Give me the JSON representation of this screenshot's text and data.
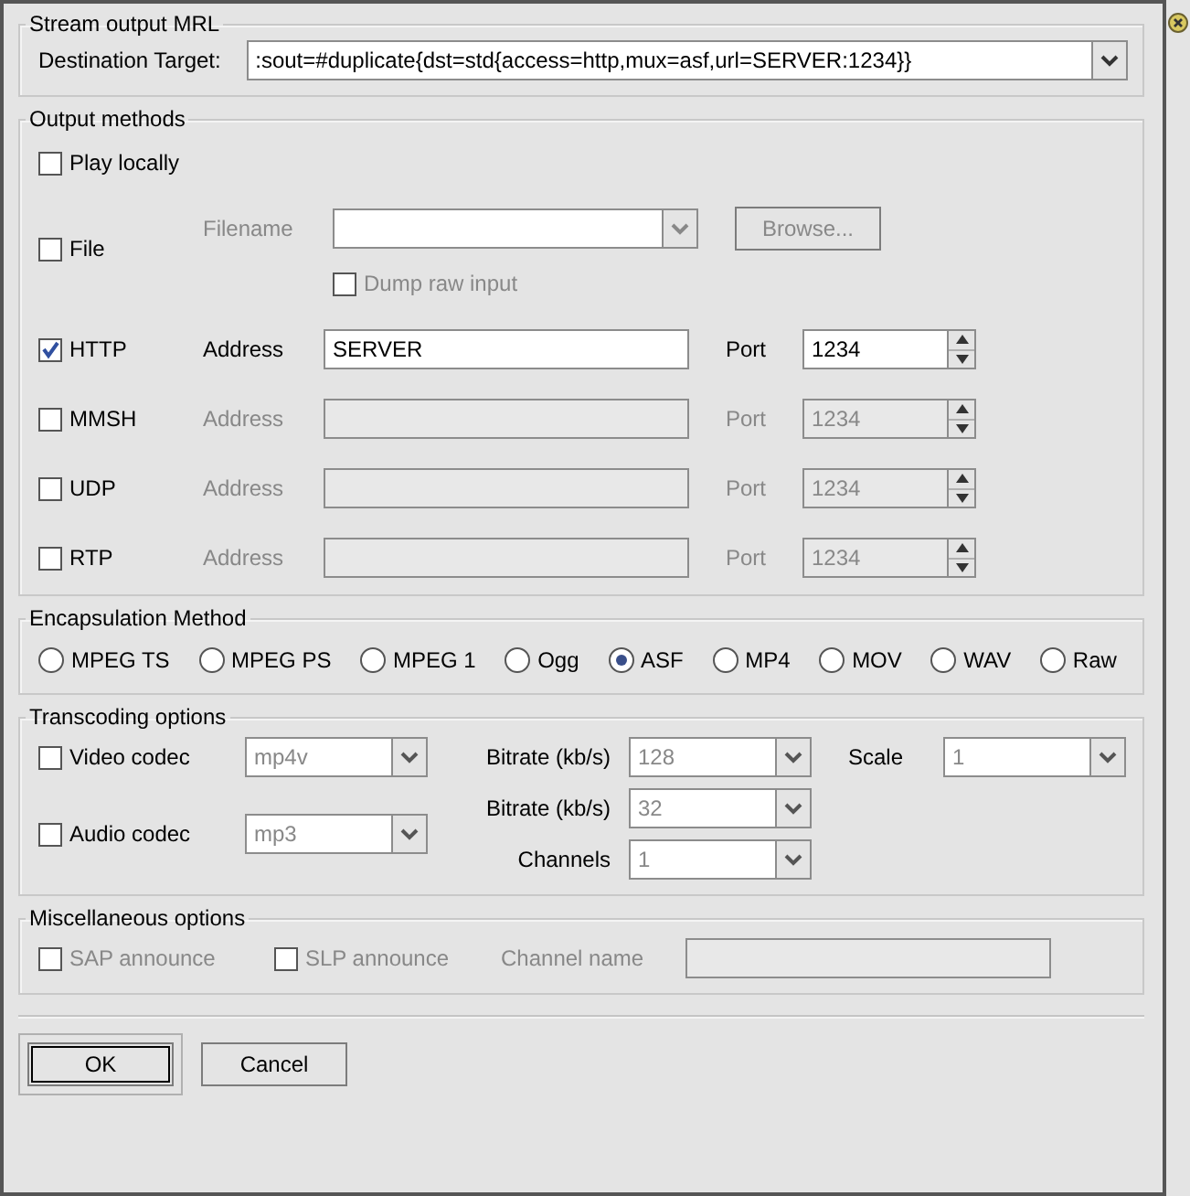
{
  "stream_output_mrl": {
    "title": "Stream output MRL",
    "label": "Destination Target:",
    "value": ":sout=#duplicate{dst=std{access=http,mux=asf,url=SERVER:1234}}"
  },
  "output_methods": {
    "title": "Output methods",
    "play_locally": {
      "label": "Play locally",
      "checked": false
    },
    "file": {
      "label": "File",
      "checked": false,
      "filename_label": "Filename",
      "browse_label": "Browse...",
      "disabled": true,
      "dump_raw": {
        "label": "Dump raw input",
        "checked": false
      }
    },
    "network": [
      {
        "label": "HTTP",
        "checked": true,
        "disabled": false,
        "address_label": "Address",
        "address_value": "SERVER",
        "port_label": "Port",
        "port_value": "1234"
      },
      {
        "label": "MMSH",
        "checked": false,
        "disabled": true,
        "address_label": "Address",
        "port_label": "Port",
        "port_value": "1234"
      },
      {
        "label": "UDP",
        "checked": false,
        "disabled": true,
        "address_label": "Address",
        "port_label": "Port",
        "port_value": "1234"
      },
      {
        "label": "RTP",
        "checked": false,
        "disabled": true,
        "address_label": "Address",
        "port_label": "Port",
        "port_value": "1234"
      }
    ]
  },
  "encapsulation": {
    "title": "Encapsulation Method",
    "options": [
      {
        "label": "MPEG TS",
        "selected": false
      },
      {
        "label": "MPEG PS",
        "selected": false
      },
      {
        "label": "MPEG 1",
        "selected": false
      },
      {
        "label": "Ogg",
        "selected": false
      },
      {
        "label": "ASF",
        "selected": true
      },
      {
        "label": "MP4",
        "selected": false
      },
      {
        "label": "MOV",
        "selected": false
      },
      {
        "label": "WAV",
        "selected": false
      },
      {
        "label": "Raw",
        "selected": false
      }
    ]
  },
  "transcoding": {
    "title": "Transcoding options",
    "video": {
      "label": "Video codec",
      "checked": false,
      "codec": "mp4v",
      "bitrate_label": "Bitrate (kb/s)",
      "bitrate": "128",
      "scale_label": "Scale",
      "scale": "1"
    },
    "audio": {
      "label": "Audio codec",
      "checked": false,
      "codec": "mp3",
      "bitrate_label": "Bitrate (kb/s)",
      "bitrate": "32",
      "channels_label": "Channels",
      "channels": "1"
    }
  },
  "misc": {
    "title": "Miscellaneous options",
    "sap": {
      "label": "SAP announce",
      "checked": false,
      "disabled": true
    },
    "slp": {
      "label": "SLP announce",
      "checked": false,
      "disabled": true
    },
    "channel_name_label": "Channel name",
    "disabled": true
  },
  "buttons": [
    {
      "label": "OK",
      "default": true
    },
    {
      "label": "Cancel",
      "default": false
    }
  ]
}
